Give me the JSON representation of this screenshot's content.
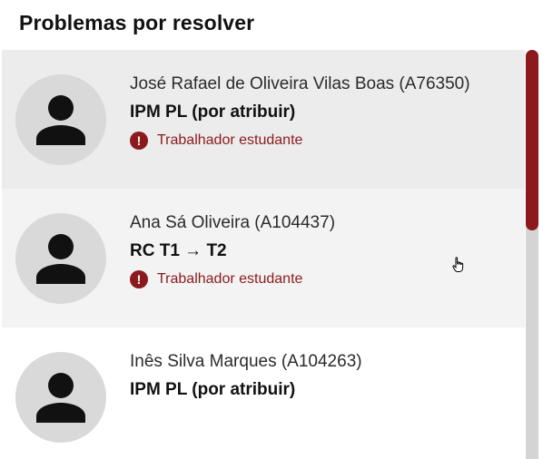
{
  "header": {
    "title": "Problemas por resolver"
  },
  "items": [
    {
      "name": "José Rafael de Oliveira Vilas Boas (A76350)",
      "problem": "IPM PL (por atribuir)",
      "warning": "Trabalhador estudante",
      "state": "selected"
    },
    {
      "name": "Ana Sá Oliveira (A104437)",
      "problem": "RC T1 → T2",
      "warning": "Trabalhador estudante",
      "state": "hover"
    },
    {
      "name": "Inês Silva Marques (A104263)",
      "problem": "IPM PL (por atribuir)",
      "warning": "",
      "state": "normal"
    }
  ],
  "icons": {
    "avatar": "person-icon",
    "warning": "exclamation-circle-icon",
    "cursor": "hand-pointer-icon"
  },
  "colors": {
    "accent": "#8a1a1e",
    "avatar_bg": "#d9d9d9",
    "selected_bg": "#ececec",
    "hover_bg": "#f3f3f3",
    "track": "#d4d4d4"
  },
  "scroll": {
    "position": 0.0,
    "visible_fraction": 0.44
  }
}
